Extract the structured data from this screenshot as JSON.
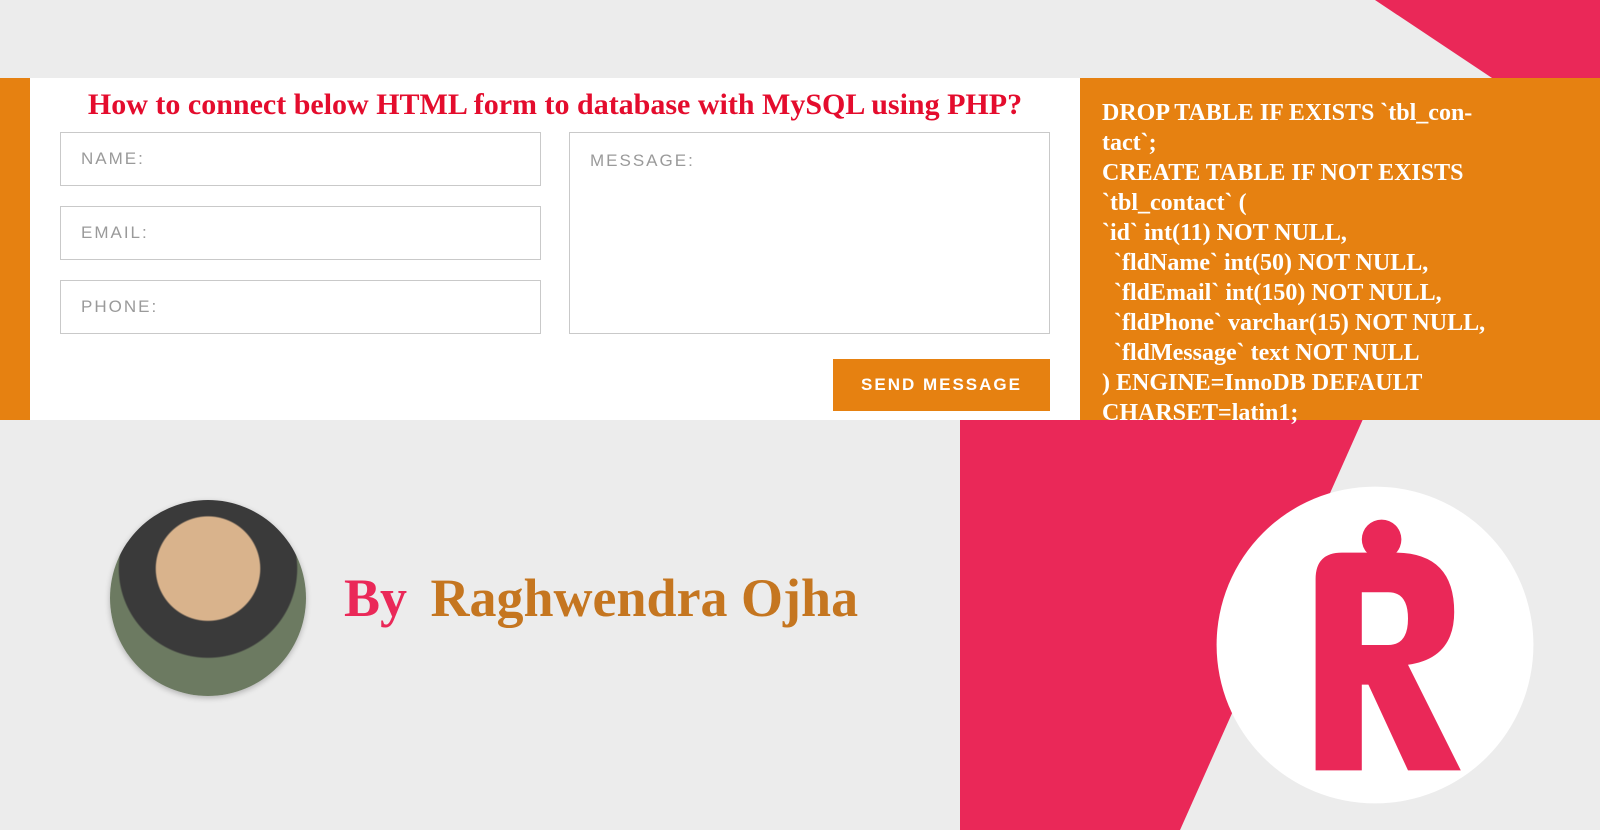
{
  "form": {
    "title": "How to connect below HTML form to database with MySQL using PHP?",
    "name_placeholder": "NAME:",
    "email_placeholder": "EMAIL:",
    "phone_placeholder": "PHONE:",
    "message_placeholder": "MESSAGE:",
    "send_label": "SEND MESSAGE"
  },
  "sql": "DROP TABLE IF EXISTS `tbl_con-\ntact`;\nCREATE TABLE IF NOT EXISTS `tbl_contact` (\n`id` int(11) NOT NULL,\n  `fldName` int(50) NOT NULL,\n  `fldEmail` int(150) NOT NULL,\n  `fldPhone` varchar(15) NOT NULL,\n  `fldMessage` text NOT NULL\n) ENGINE=InnoDB DEFAULT CHARSET=latin1;",
  "byline": {
    "by": "By",
    "name": "Raghwendra Ojha"
  }
}
